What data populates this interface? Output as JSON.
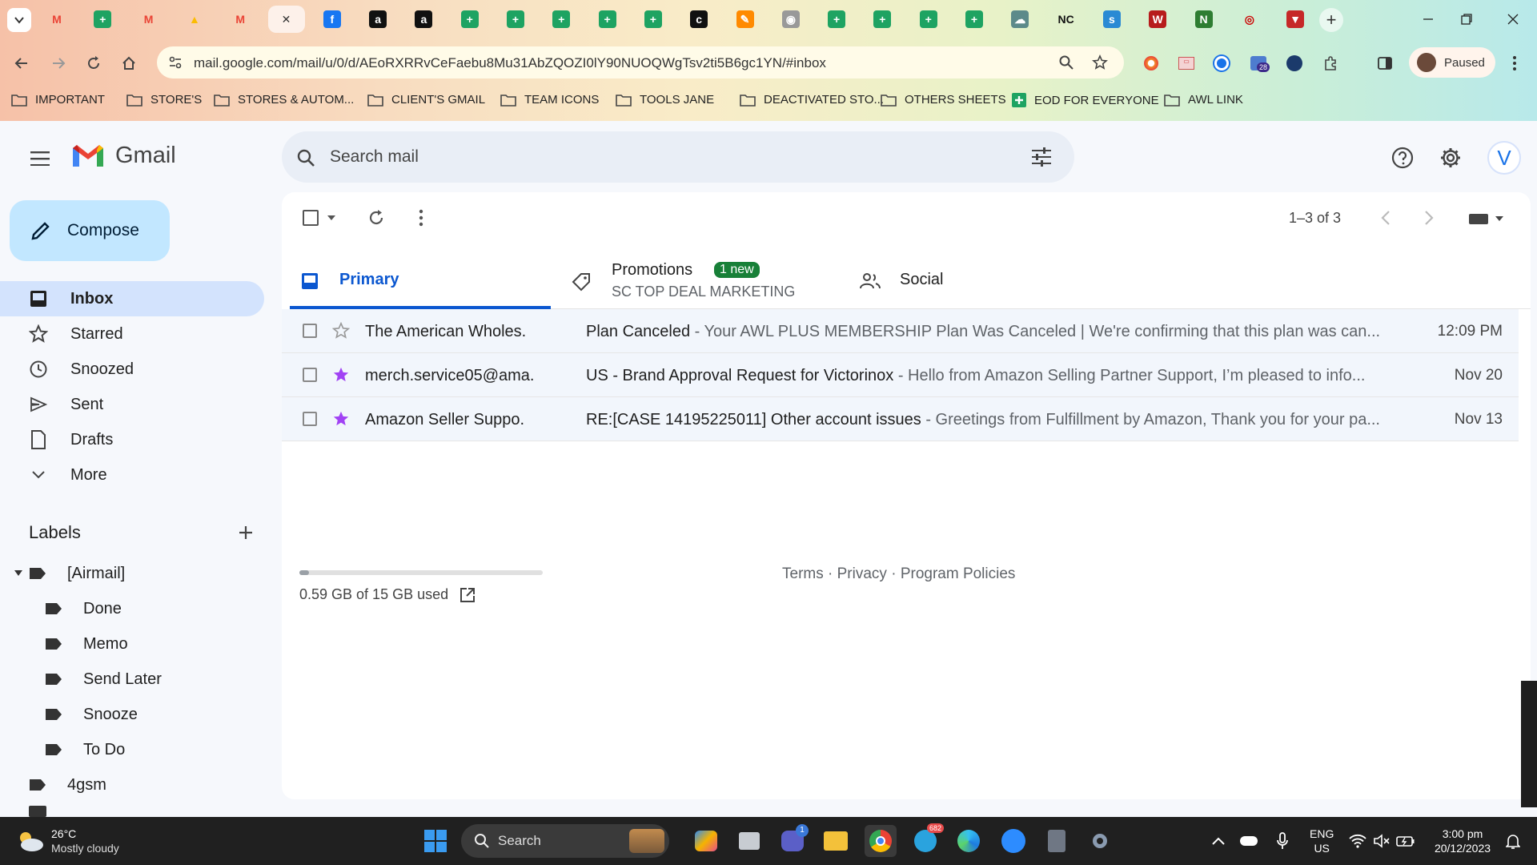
{
  "browser": {
    "url": "mail.google.com/mail/u/0/d/AEoRXRRvCeFaebu8Mu31AbZQOZI0lY90NUOQWgTsv2ti5B6gc1YN/#inbox",
    "profile_label": "Paused",
    "tab_icons": [
      "gmail-icon",
      "sheets-icon",
      "gmail-icon",
      "drive-icon",
      "gmail-icon",
      "gmail-icon",
      "facebook-icon",
      "amazon-icon",
      "amazon-icon",
      "sheets-icon",
      "sheets-icon",
      "sheets-icon",
      "sheets-icon",
      "sheets-icon",
      "circle-c-icon",
      "pencil-app-icon",
      "globe-icon",
      "sheets-icon",
      "sheets-icon",
      "sheets-icon",
      "sheets-icon",
      "cloud-icon",
      "nc-icon",
      "sysco-icon",
      "w-icon",
      "n-icon",
      "logo-icon",
      "v-icon"
    ],
    "extension_badge": "28",
    "bookmarks": [
      {
        "label": "IMPORTANT",
        "icon": "folder-icon"
      },
      {
        "label": "STORE'S",
        "icon": "folder-icon"
      },
      {
        "label": "STORES & AUTOM...",
        "icon": "folder-icon"
      },
      {
        "label": "CLIENT'S GMAIL",
        "icon": "folder-icon"
      },
      {
        "label": "TEAM ICONS",
        "icon": "folder-icon"
      },
      {
        "label": "TOOLS JANE",
        "icon": "folder-icon"
      },
      {
        "label": "DEACTIVATED STO...",
        "icon": "folder-icon"
      },
      {
        "label": "OTHERS SHEETS",
        "icon": "folder-icon"
      },
      {
        "label": "EOD FOR EVERYONE",
        "icon": "sheets-icon"
      },
      {
        "label": "AWL LINK",
        "icon": "folder-icon"
      }
    ]
  },
  "gmail": {
    "logo_text": "Gmail",
    "search_placeholder": "Search mail",
    "avatar_letter": "V",
    "compose_label": "Compose",
    "nav": [
      {
        "label": "Inbox",
        "icon": "inbox-icon",
        "selected": true
      },
      {
        "label": "Starred",
        "icon": "star-icon"
      },
      {
        "label": "Snoozed",
        "icon": "clock-icon"
      },
      {
        "label": "Sent",
        "icon": "send-icon"
      },
      {
        "label": "Drafts",
        "icon": "draft-icon"
      },
      {
        "label": "More",
        "icon": "chevron-down-icon"
      }
    ],
    "labels_heading": "Labels",
    "labels": [
      {
        "label": "[Airmail]",
        "level": 0,
        "expanded": true
      },
      {
        "label": "Done",
        "level": 1
      },
      {
        "label": "Memo",
        "level": 1
      },
      {
        "label": "Send Later",
        "level": 1
      },
      {
        "label": "Snooze",
        "level": 1
      },
      {
        "label": "To Do",
        "level": 1
      },
      {
        "label": "4gsm",
        "level": 0
      }
    ],
    "pagination": "1–3 of 3",
    "tabs": {
      "primary": "Primary",
      "promotions": "Promotions",
      "promotions_badge": "1 new",
      "promotions_sub": "SC TOP DEAL MARKETING",
      "social": "Social"
    },
    "emails": [
      {
        "sender": "The American Wholes.",
        "subject": "Plan Canceled",
        "snippet": " - Your AWL PLUS MEMBERSHIP Plan Was Canceled | We're confirming that this plan was can...",
        "date": "12:09 PM",
        "starred": false
      },
      {
        "sender": "merch.service05@ama.",
        "subject": "US - Brand Approval Request for Victorinox",
        "snippet": " - Hello from Amazon Selling Partner Support, I’m pleased to info...",
        "date": "Nov 20",
        "starred": true
      },
      {
        "sender": "Amazon Seller Suppo.",
        "subject": "RE:[CASE 14195225011] Other account issues",
        "snippet": " - Greetings from Fulfillment by Amazon, Thank you for your pa...",
        "date": "Nov 13",
        "starred": true
      }
    ],
    "storage_text": "0.59 GB of 15 GB used",
    "storage_fraction": 0.039,
    "footer": {
      "terms": "Terms",
      "privacy": "Privacy",
      "policies": "Program Policies",
      "sep": " · "
    },
    "colors": {
      "selected_nav": "#d3e3fd",
      "compose": "#c2e7ff",
      "primary_blue": "#0b57d0",
      "badge_green": "#188038",
      "star_purple": "#a142f4"
    }
  },
  "taskbar": {
    "weather_temp": "26°C",
    "weather_desc": "Mostly cloudy",
    "search_label": "Search",
    "lang_top": "ENG",
    "lang_bottom": "US",
    "time": "3:00 pm",
    "date": "20/12/2023",
    "chat_badge": "1",
    "telegram_badge": "682"
  }
}
